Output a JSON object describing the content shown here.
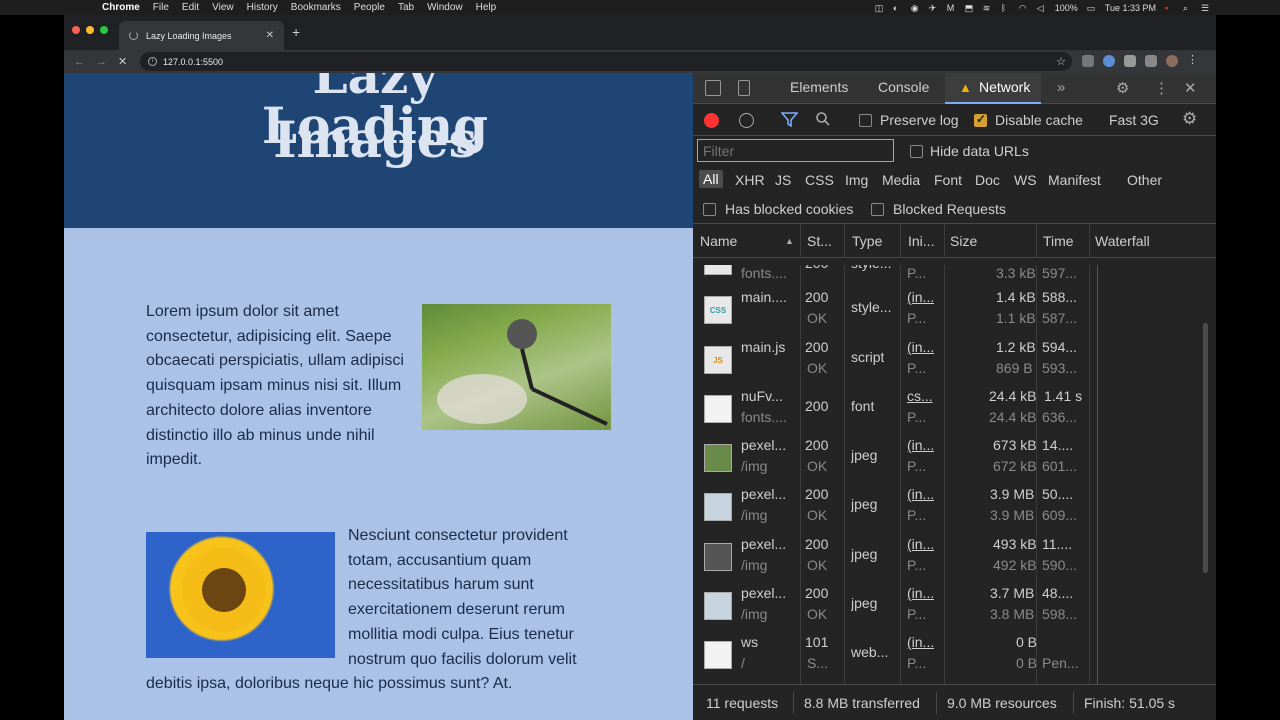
{
  "menubar": {
    "app": "Chrome",
    "items": [
      "File",
      "Edit",
      "View",
      "History",
      "Bookmarks",
      "People",
      "Tab",
      "Window",
      "Help"
    ],
    "battery": "100%",
    "clock": "Tue 1:33 PM"
  },
  "browser": {
    "tab_title": "Lazy Loading Images",
    "url": "127.0.0.1:5500"
  },
  "page": {
    "title_top": "Lazy Loading",
    "title": "Images",
    "para1": "Lorem ipsum dolor sit amet consectetur, adipisicing elit. Saepe obcaecati perspiciatis, ullam adipisci quisquam ipsam minus nisi sit. Illum architecto dolore alias inventore distinctio illo ab minus unde nihil impedit.",
    "para2": "Nesciunt consectetur provident totam, accusantium quam necessitatibus harum sunt exercitationem deserunt rerum mollitia modi culpa. Eius tenetur nostrum quo facilis dolorum velit debitis ipsa, doloribus neque hic possimus sunt? At."
  },
  "devtools": {
    "tabs": [
      "Elements",
      "Console",
      "Network"
    ],
    "active_tab": "Network",
    "toolbar": {
      "preserve_log": "Preserve log",
      "disable_cache": "Disable cache",
      "throttle": "Fast 3G"
    },
    "filter_placeholder": "Filter",
    "hide_data_urls": "Hide data URLs",
    "types": [
      "All",
      "XHR",
      "JS",
      "CSS",
      "Img",
      "Media",
      "Font",
      "Doc",
      "WS",
      "Manifest",
      "Other"
    ],
    "has_blocked_cookies": "Has blocked cookies",
    "blocked_requests": "Blocked Requests",
    "columns": {
      "name": "Name",
      "status": "St...",
      "type": "Type",
      "initiator": "Ini...",
      "size": "Size",
      "time": "Time",
      "waterfall": "Waterfall"
    },
    "rows": [
      {
        "icon": "CSS",
        "name1": "",
        "name2": "fonts....",
        "status1": "200",
        "status2": "",
        "type": "style...",
        "init1": "",
        "init2": "P...",
        "size1": "",
        "size2": "3.3 kB",
        "time1": "",
        "time2": "597..."
      },
      {
        "icon": "CSS",
        "name1": "main....",
        "name2": "",
        "status1": "200",
        "status2": "OK",
        "type": "style...",
        "init1": "(in...",
        "init2": "P...",
        "size1": "1.4 kB",
        "size2": "1.1 kB",
        "time1": "588...",
        "time2": "587..."
      },
      {
        "icon": "JS",
        "name1": "main.js",
        "name2": "",
        "status1": "200",
        "status2": "OK",
        "type": "script",
        "init1": "(in...",
        "init2": "P...",
        "size1": "1.2 kB",
        "size2": "869 B",
        "time1": "594...",
        "time2": "593..."
      },
      {
        "icon": "",
        "name1": "nuFv...",
        "name2": "fonts....",
        "status1": "200",
        "status2": "",
        "type": "font",
        "init1": "cs...",
        "init2": "P...",
        "size1": "24.4 kB",
        "size2": "24.4 kB",
        "time1": "1.41 s",
        "time2": "636..."
      },
      {
        "icon": "IMG",
        "name1": "pexel...",
        "name2": "/img",
        "status1": "200",
        "status2": "OK",
        "type": "jpeg",
        "init1": "(in...",
        "init2": "P...",
        "size1": "673 kB",
        "size2": "672 kB",
        "time1": "14....",
        "time2": "601..."
      },
      {
        "icon": "IMG",
        "name1": "pexel...",
        "name2": "/img",
        "status1": "200",
        "status2": "OK",
        "type": "jpeg",
        "init1": "(in...",
        "init2": "P...",
        "size1": "3.9 MB",
        "size2": "3.9 MB",
        "time1": "50....",
        "time2": "609..."
      },
      {
        "icon": "IMG",
        "name1": "pexel...",
        "name2": "/img",
        "status1": "200",
        "status2": "OK",
        "type": "jpeg",
        "init1": "(in...",
        "init2": "P...",
        "size1": "493 kB",
        "size2": "492 kB",
        "time1": "11....",
        "time2": "590..."
      },
      {
        "icon": "IMG",
        "name1": "pexel...",
        "name2": "/img",
        "status1": "200",
        "status2": "OK",
        "type": "jpeg",
        "init1": "(in...",
        "init2": "P...",
        "size1": "3.7 MB",
        "size2": "3.8 MB",
        "time1": "48....",
        "time2": "598..."
      },
      {
        "icon": "",
        "name1": "ws",
        "name2": "/",
        "status1": "101",
        "status2": "S...",
        "type": "web...",
        "init1": "(in...",
        "init2": "P...",
        "size1": "0 B",
        "size2": "0 B",
        "time1": "",
        "time2": "Pen..."
      }
    ],
    "status": {
      "requests": "11 requests",
      "transferred": "8.8 MB transferred",
      "resources": "9.0 MB resources",
      "finish": "Finish: 51.05 s"
    }
  }
}
